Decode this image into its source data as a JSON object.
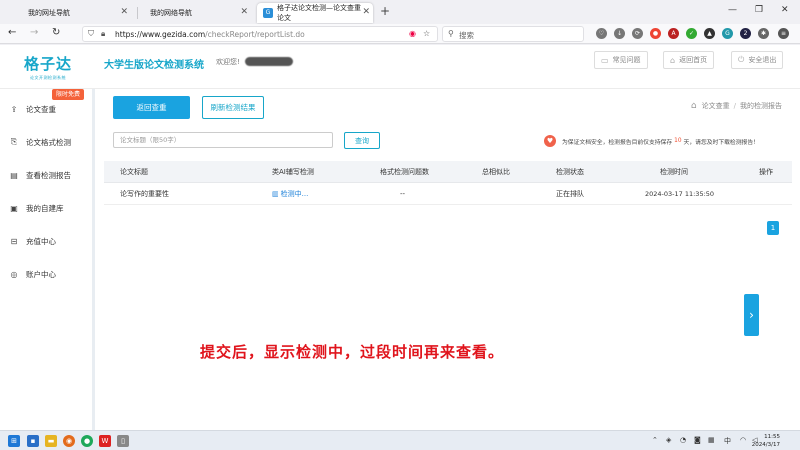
{
  "browser": {
    "tabs": [
      {
        "label": "我的网址导航",
        "active": false
      },
      {
        "label": "我的网络导航",
        "active": false
      },
      {
        "label": "格子达论文检测—论文查重 论文",
        "active": true
      }
    ],
    "new_tab": "+",
    "window_controls": {
      "minimize": "—",
      "restore": "❐",
      "close": "✕"
    },
    "url_host": "https://www.gezida.com",
    "url_path": "/checkReport/reportList.do",
    "search_placeholder": "搜索"
  },
  "header": {
    "logo_text": "格子达",
    "logo_sub": "论文开测检测系统",
    "site_title": "大学生版论文检测系统",
    "welcome": "欢迎您!",
    "buttons": [
      {
        "label": "常见问题",
        "icon": "chat-icon"
      },
      {
        "label": "返回首页",
        "icon": "home-icon"
      },
      {
        "label": "安全退出",
        "icon": "power-icon"
      }
    ]
  },
  "sidebar": {
    "promo_badge": "限时免费",
    "items": [
      {
        "label": "论文查重",
        "icon": "upload-icon"
      },
      {
        "label": "论文格式检测",
        "icon": "format-icon"
      },
      {
        "label": "查看检测报告",
        "icon": "report-icon"
      },
      {
        "label": "我的自建库",
        "icon": "library-icon"
      },
      {
        "label": "充值中心",
        "icon": "recharge-icon"
      },
      {
        "label": "账户中心",
        "icon": "account-icon"
      }
    ]
  },
  "main": {
    "back_button": "返回查重",
    "refresh_button": "刷新检测结果",
    "breadcrumb": {
      "home": "论文查重",
      "current": "我的检测报告"
    },
    "search": {
      "placeholder": "论文标题（限50字）",
      "value": "",
      "button": "查询"
    },
    "notice": {
      "before": "为保证文档安全，检测报告目前仅支持保存",
      "days": "10",
      "after": "天，请您及时下载检测报告！"
    },
    "table": {
      "headers": [
        "论文标题",
        "类AI辅写检测",
        "格式检测问题数",
        "总相似比",
        "检测状态",
        "检测时间",
        "操作"
      ],
      "rows": [
        {
          "title": "论写作的重要性",
          "ai_check": "检测中...",
          "format_issues": "--",
          "similarity": "",
          "status": "正在排队",
          "time": "2024-03-17 11:35:50",
          "action": ""
        }
      ]
    },
    "page_number": "1",
    "caption": "提交后，显示检测中，过段时间再来查看。"
  },
  "taskbar": {
    "time": "11:55",
    "date": "2024/3/17"
  },
  "colors": {
    "accent": "#1aa3e0",
    "brand": "#17a6c9",
    "promo": "#f4623a",
    "caption": "#e0141c"
  }
}
